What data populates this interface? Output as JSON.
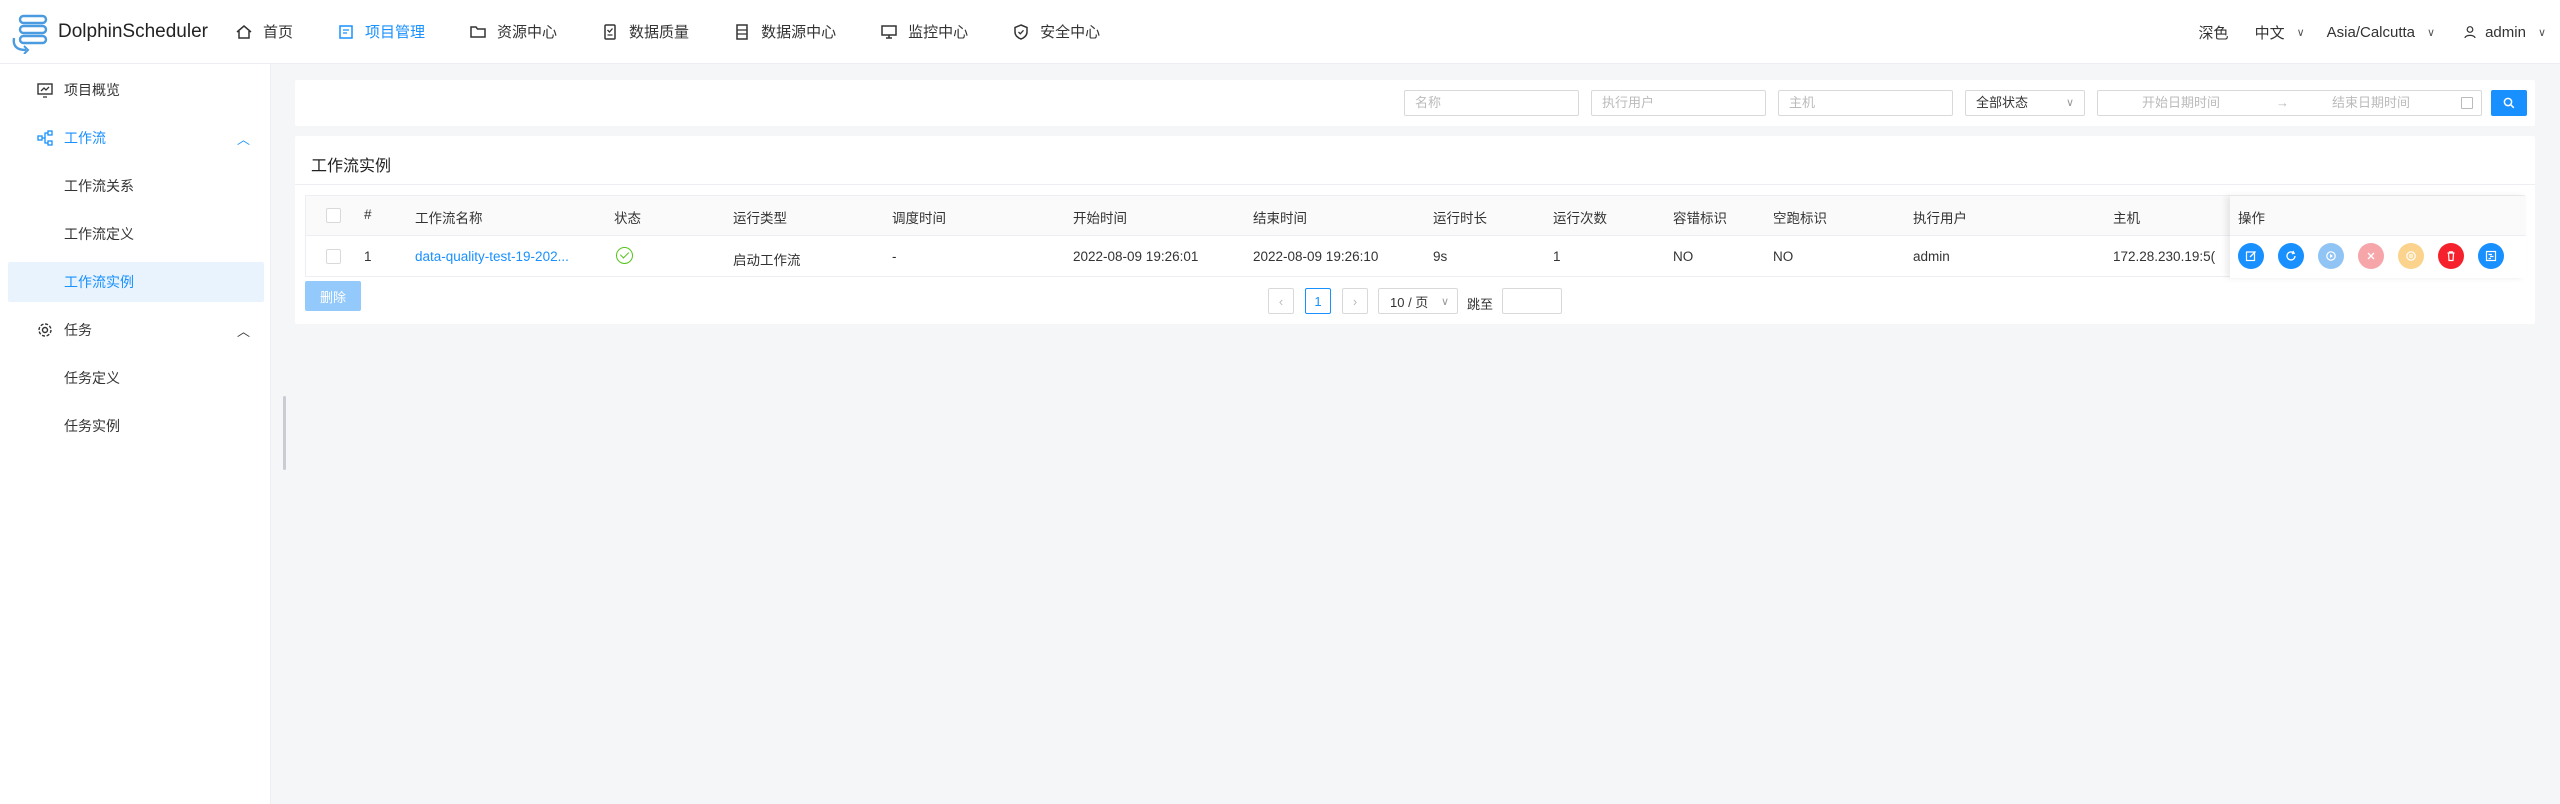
{
  "app": {
    "title": "DolphinScheduler"
  },
  "nav": [
    {
      "label": "首页",
      "icon": "home-icon"
    },
    {
      "label": "项目管理",
      "icon": "project-icon",
      "active": true
    },
    {
      "label": "资源中心",
      "icon": "folder-icon"
    },
    {
      "label": "数据质量",
      "icon": "data-quality-icon"
    },
    {
      "label": "数据源中心",
      "icon": "datasource-icon"
    },
    {
      "label": "监控中心",
      "icon": "monitor-icon"
    },
    {
      "label": "安全中心",
      "icon": "shield-icon"
    }
  ],
  "header_right": {
    "theme": "深色",
    "language": "中文",
    "timezone": "Asia/Calcutta",
    "user": "admin"
  },
  "sidebar": {
    "overview": "项目概览",
    "workflow_group": "工作流",
    "workflow_items": [
      "工作流关系",
      "工作流定义",
      "工作流实例"
    ],
    "task_group": "任务",
    "task_items": [
      "任务定义",
      "任务实例"
    ],
    "selected": "工作流实例"
  },
  "filters": {
    "name_placeholder": "名称",
    "executor_placeholder": "执行用户",
    "host_placeholder": "主机",
    "status_value": "全部状态",
    "start_date_placeholder": "开始日期时间",
    "end_date_placeholder": "结束日期时间",
    "date_separator": "→"
  },
  "table": {
    "title": "工作流实例",
    "columns": [
      "#",
      "工作流名称",
      "状态",
      "运行类型",
      "调度时间",
      "开始时间",
      "结束时间",
      "运行时长",
      "运行次数",
      "容错标识",
      "空跑标识",
      "执行用户",
      "主机",
      "操作"
    ],
    "rows": [
      {
        "index": "1",
        "name": "data-quality-test-19-202...",
        "status": "success",
        "run_type": "启动工作流",
        "schedule_time": "-",
        "start_time": "2022-08-09 19:26:01",
        "end_time": "2022-08-09 19:26:10",
        "duration": "9s",
        "run_times": "1",
        "fault_tolerant": "NO",
        "dry_run": "NO",
        "executor": "admin",
        "host": "172.28.230.19:5("
      }
    ],
    "op_colors": [
      "#1890ff",
      "#1890ff",
      "#90c4f5",
      "#f6a5a9",
      "#fbd38d",
      "#f5222d",
      "#1890ff"
    ]
  },
  "footer": {
    "delete_label": "删除",
    "page": "1",
    "page_size": "10 / 页",
    "jump_label": "跳至",
    "prev": "‹",
    "next": "›"
  }
}
